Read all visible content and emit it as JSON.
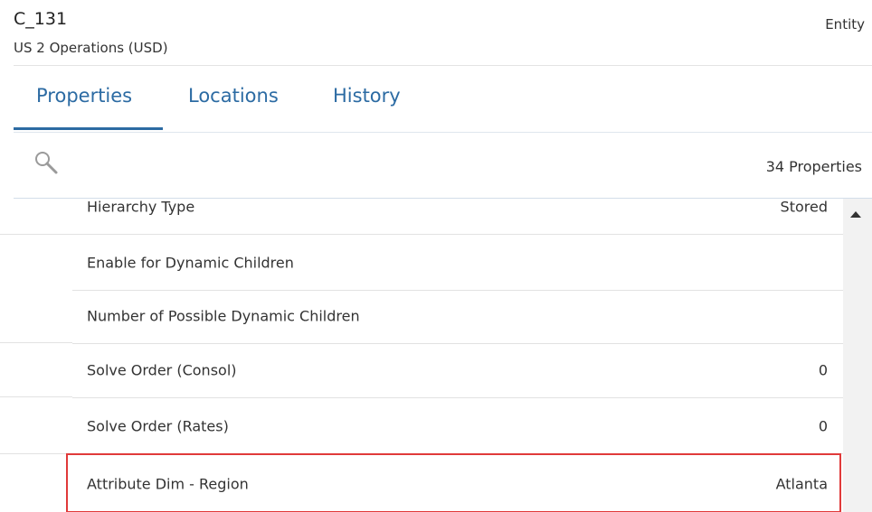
{
  "header": {
    "member_name": "C_131",
    "description": "US 2 Operations (USD)",
    "dimension_type": "Entity"
  },
  "tabs": [
    {
      "label": "Properties",
      "active": true
    },
    {
      "label": "Locations",
      "active": false
    },
    {
      "label": "History",
      "active": false
    }
  ],
  "toolbar": {
    "search_icon": "magnifier-icon",
    "properties_count": "34 Properties"
  },
  "properties": [
    {
      "label": "Hierarchy Type",
      "value": "Stored"
    },
    {
      "label": "Enable for Dynamic Children",
      "value": ""
    },
    {
      "label": "Number of Possible Dynamic Children",
      "value": ""
    },
    {
      "label": "Solve Order (Consol)",
      "value": "0"
    },
    {
      "label": "Solve Order (Rates)",
      "value": "0"
    },
    {
      "label": "Attribute Dim - Region",
      "value": "Atlanta",
      "highlighted": true
    }
  ],
  "colors": {
    "accent": "#2c6ba3",
    "highlight_border": "#e03a3a",
    "scrollbar_track": "#f2f2f2"
  }
}
